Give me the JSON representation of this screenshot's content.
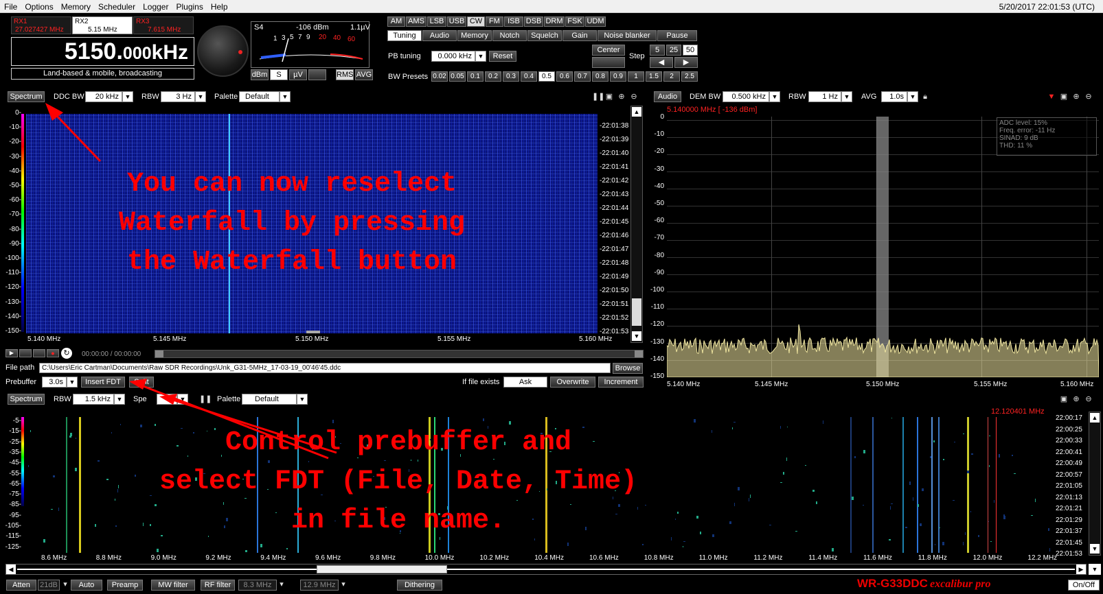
{
  "menu": {
    "items": [
      "File",
      "Options",
      "Memory",
      "Scheduler",
      "Logger",
      "Plugins",
      "Help"
    ],
    "datetime": "5/20/2017 22:01:53 (UTC)"
  },
  "rx": {
    "rx1_label": "RX1",
    "rx1_freq": "27.027427 MHz",
    "rx2_label": "RX2",
    "rx2_freq": "5.15 MHz",
    "rx3_label": "RX3",
    "rx3_freq": "7.615 MHz",
    "main_freq_big": "5150.",
    "main_freq_small": "000",
    "main_freq_unit": "kHz",
    "band_desc": "Land-based & mobile, broadcasting"
  },
  "smeter": {
    "s_label": "S4",
    "dbm": "-106 dBm",
    "uv": "1.1µV",
    "scale": [
      "1",
      "3",
      "5",
      "7",
      "9",
      "20",
      "40",
      "60"
    ],
    "units": [
      "dBm",
      "S",
      "µV"
    ],
    "selected_unit": "S",
    "rms": "RMS",
    "avg": "AVG"
  },
  "modes": {
    "items": [
      "AM",
      "AMS",
      "LSB",
      "USB",
      "CW",
      "FM",
      "ISB",
      "DSB",
      "DRM",
      "FSK",
      "UDM"
    ],
    "selected": "CW"
  },
  "tabs": {
    "items": [
      "Tuning",
      "Audio",
      "Memory",
      "Notch",
      "Squelch",
      "Gain",
      "Noise blanker",
      "Pause"
    ],
    "selected": "Tuning"
  },
  "tuning": {
    "pb_label": "PB tuning",
    "pb_value": "0.000 kHz",
    "reset": "Reset",
    "center": "Center",
    "step_label": "Step",
    "steps": [
      "5",
      "25",
      "50"
    ],
    "step_selected": "50",
    "bw_label": "BW Presets",
    "bw": [
      "0.02",
      "0.05",
      "0.1",
      "0.2",
      "0.3",
      "0.4",
      "0.5",
      "0.6",
      "0.7",
      "0.8",
      "0.9",
      "1",
      "1.5",
      "2",
      "2.5"
    ],
    "bw_selected": "0.5"
  },
  "ddc": {
    "spectrum_btn": "Spectrum",
    "ddcbw_label": "DDC BW",
    "ddcbw_value": "20 kHz",
    "rbw_label": "RBW",
    "rbw_value": "3 Hz",
    "palette_label": "Palette",
    "palette_value": "Default",
    "yticks": [
      "0-",
      "-10-",
      "-20-",
      "-30-",
      "-40-",
      "-50-",
      "-60-",
      "-70-",
      "-80-",
      "-90-",
      "-100-",
      "-110-",
      "-120-",
      "-130-",
      "-140-",
      "-150-"
    ],
    "xticks": [
      "5.140 MHz",
      "5.145 MHz",
      "5.150 MHz",
      "5.155 MHz",
      "5.160 MHz"
    ],
    "times": [
      "-22:01:38",
      "-22:01:39",
      "-22:01:40",
      "-22:01:41",
      "-22:01:42",
      "-22:01:43",
      "-22:01:44",
      "-22:01:45",
      "-22:01:46",
      "-22:01:47",
      "-22:01:48",
      "-22:01:49",
      "-22:01:50",
      "-22:01:51",
      "-22:01:52",
      "-22:01:53"
    ]
  },
  "audio": {
    "audio_btn": "Audio",
    "dembw_label": "DEM BW",
    "dembw_value": "0.500 kHz",
    "rbw_label": "RBW",
    "rbw_value": "1 Hz",
    "avg_label": "AVG",
    "avg_value": "1.0s",
    "cursor": "5.140000 MHz [ -136 dBm]",
    "yticks": [
      "0",
      "-10",
      "-20",
      "-30",
      "-40",
      "-50",
      "-60",
      "-70",
      "-80",
      "-90",
      "-100",
      "-110",
      "-120",
      "-130",
      "-140",
      "-150"
    ],
    "xticks": [
      "5.140 MHz",
      "5.145 MHz",
      "5.150 MHz",
      "5.155 MHz",
      "5.160 MHz"
    ],
    "info": [
      "ADC level: 15%",
      "Freq. error: -11 Hz",
      "SINAD: 9 dB",
      "THD: 11 %"
    ]
  },
  "recorder": {
    "time": "00:00:00 / 00:00:00",
    "filepath_label": "File path",
    "filepath": "C:\\Users\\Eric Cartman\\Documents\\Raw SDR Recordings\\Unk_G31-5MHz_17-03-19_00'46'45.ddc",
    "browse": "Browse",
    "prebuffer_label": "Prebuffer",
    "prebuffer_value": "3.0s",
    "insert_fdt": "Insert FDT",
    "split": "Split",
    "iffile_label": "If file exists",
    "ask": "Ask",
    "overwrite": "Overwrite",
    "increment": "Increment"
  },
  "wide": {
    "spectrum_btn": "Spectrum",
    "rbw_label": "RBW",
    "rbw_value": "1.5 kHz",
    "speed_label": "Spe",
    "speed_value": "1",
    "palette_label": "Palette",
    "palette_value": "Default",
    "marker": "12.120401 MHz",
    "yticks": [
      "-5-",
      "-15-",
      "-25-",
      "-35-",
      "-45-",
      "-55-",
      "-65-",
      "-75-",
      "-85-",
      "-95-",
      "-105-",
      "-115-",
      "-125-"
    ],
    "xticks": [
      "8.6 MHz",
      "8.8 MHz",
      "9.0 MHz",
      "9.2 MHz",
      "9.4 MHz",
      "9.6 MHz",
      "9.8 MHz",
      "10.0 MHz",
      "10.2 MHz",
      "10.4 MHz",
      "10.6 MHz",
      "10.8 MHz",
      "11.0 MHz",
      "11.2 MHz",
      "11.4 MHz",
      "11.6 MHz",
      "11.8 MHz",
      "12.0 MHz",
      "12.2 MHz"
    ],
    "times": [
      "22:00:17",
      "22:00:25",
      "22:00:33",
      "22:00:41",
      "22:00:49",
      "22:00:57",
      "22:01:05",
      "22:01:13",
      "22:01:21",
      "22:01:29",
      "22:01:37",
      "22:01:45",
      "22:01:53"
    ]
  },
  "bottom": {
    "atten": "Atten",
    "atten_val": "21dB",
    "auto": "Auto",
    "preamp": "Preamp",
    "mwfilter": "MW filter",
    "rffilter": "RF filter",
    "rf_val": "8.3 MHz",
    "hf_val": "12.9 MHz",
    "dithering": "Dithering",
    "brand_main": "WR-G33DDC",
    "brand_sub": "excalibur pro",
    "onoff": "On/Off"
  },
  "annotations": {
    "a1": "You can now reselect\nWaterfall by pressing\nthe Waterfall button",
    "a2": "Control prebuffer and\nselect FDT (File, Date, Time)\nin file name."
  },
  "colors": {
    "accent": "#ff0000",
    "waterfall": "#0a147a",
    "spectrum": "#f0e6a0"
  }
}
